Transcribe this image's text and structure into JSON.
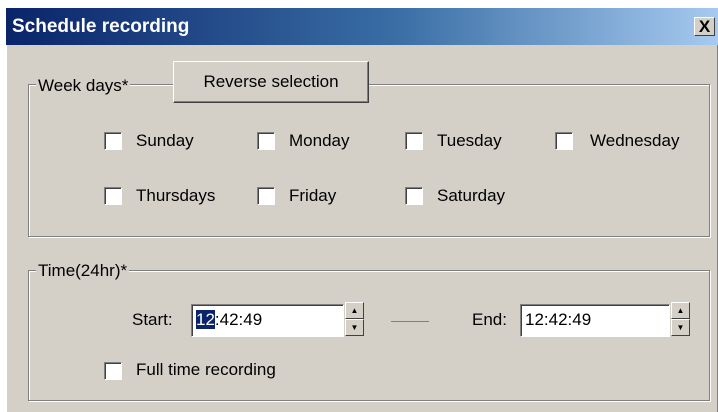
{
  "window": {
    "title": "Schedule recording",
    "close_label": "X"
  },
  "weekdays": {
    "legend": "Week days*",
    "reverse_label": "Reverse selection",
    "days": [
      "Sunday",
      "Monday",
      "Tuesday",
      "Wednesday",
      "Thursdays",
      "Friday",
      "Saturday"
    ]
  },
  "time": {
    "legend": "Time(24hr)*",
    "start_label": "Start:",
    "start_hour": "12",
    "start_rest": ":42:49",
    "end_label": "End:",
    "end_value": "12:42:49",
    "full_time_label": "Full time recording"
  }
}
